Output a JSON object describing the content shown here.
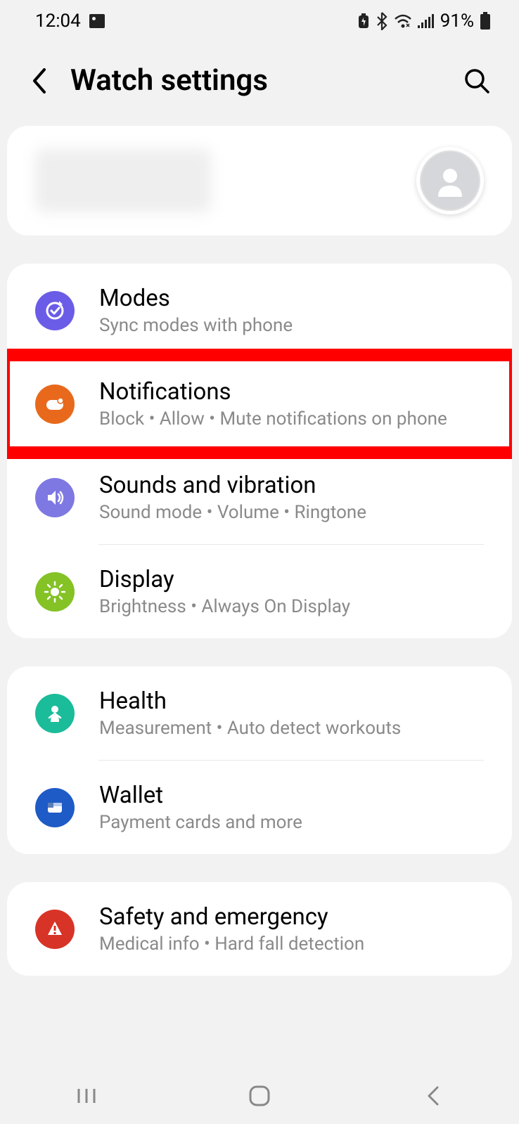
{
  "status": {
    "time": "12:04",
    "battery": "91%"
  },
  "header": {
    "title": "Watch settings"
  },
  "settings": {
    "modes": {
      "title": "Modes",
      "sub": "Sync modes with phone"
    },
    "notifications": {
      "title": "Notifications",
      "sub": "Block • Allow • Mute notifications on phone"
    },
    "sounds": {
      "title": "Sounds and vibration",
      "sub": "Sound mode • Volume • Ringtone"
    },
    "display": {
      "title": "Display",
      "sub": "Brightness • Always On Display"
    },
    "health": {
      "title": "Health",
      "sub": "Measurement • Auto detect workouts"
    },
    "wallet": {
      "title": "Wallet",
      "sub": "Payment cards and more"
    },
    "safety": {
      "title": "Safety and emergency",
      "sub": "Medical info • Hard fall detection"
    }
  }
}
